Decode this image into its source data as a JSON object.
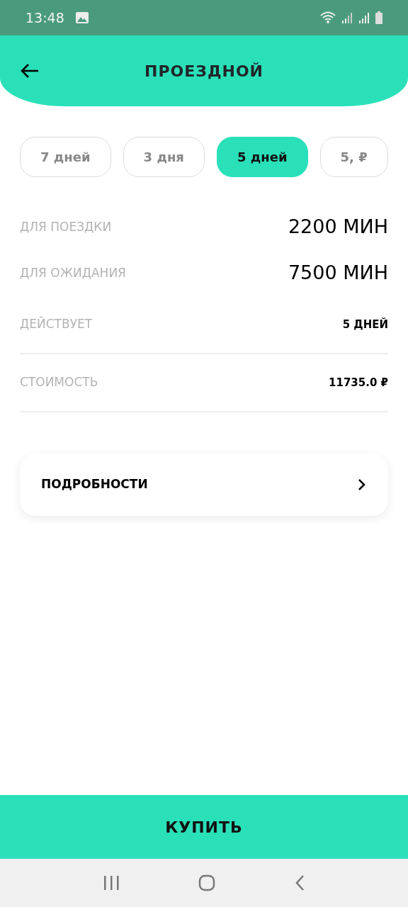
{
  "status_bar": {
    "time": "13:48"
  },
  "header": {
    "title": "ПРОЕЗДНОЙ"
  },
  "tabs": [
    {
      "label": "7 дней",
      "selected": false
    },
    {
      "label": "3 дня",
      "selected": false
    },
    {
      "label": "5 дней",
      "selected": true
    },
    {
      "label": "5, ₽",
      "selected": false
    }
  ],
  "rows": [
    {
      "label": "ДЛЯ ПОЕЗДКИ",
      "value": "2200 МИН",
      "kind": "big",
      "divider": false
    },
    {
      "label": "ДЛЯ ОЖИДАНИЯ",
      "value": "7500 МИН",
      "kind": "big",
      "divider": false
    },
    {
      "label": "ДЕЙСТВУЕТ",
      "value": "5 ДНЕЙ",
      "kind": "small",
      "divider": true
    },
    {
      "label": "СТОИМОСТЬ",
      "value": "11735.0 ₽",
      "kind": "small",
      "divider": true
    }
  ],
  "details": {
    "label": "ПОДРОБНОСТИ"
  },
  "buy_button": {
    "label": "КУПИТЬ"
  }
}
